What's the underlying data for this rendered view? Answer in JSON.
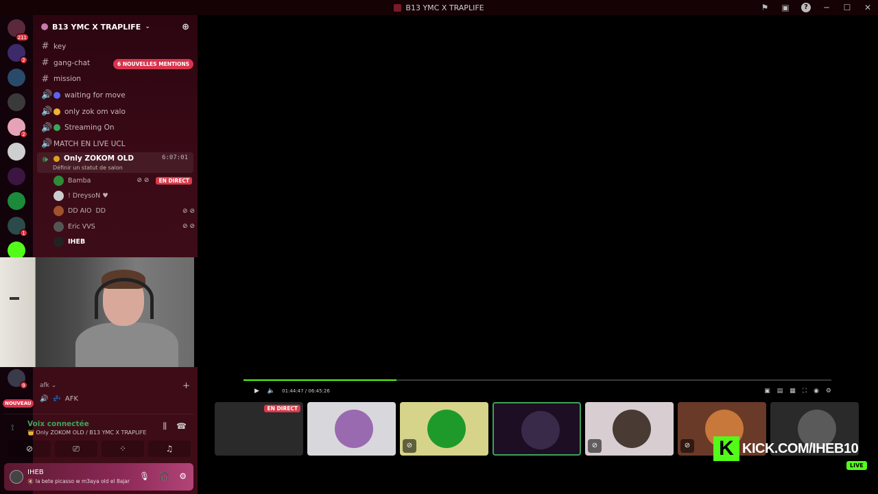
{
  "window": {
    "title": "B13 YMC X TRAPLIFE"
  },
  "rail": {
    "home_badge": "211",
    "servers": [
      {
        "color": "#3c2a6a",
        "badge": "2"
      },
      {
        "color": "#2a4a6a",
        "badge": ""
      },
      {
        "color": "#3a3a3a",
        "badge": ""
      },
      {
        "color": "#e6a3b8",
        "badge": "2"
      },
      {
        "color": "#cfcfcf",
        "badge": ""
      },
      {
        "color": "#3a1640",
        "badge": ""
      },
      {
        "color": "#1b8a3a",
        "badge": ""
      },
      {
        "color": "#2c4a4a",
        "badge": "1"
      },
      {
        "color": "#53fc18",
        "badge": ""
      }
    ]
  },
  "sidebar": {
    "server_name": "B13 YMC X TRAPLIFE",
    "mentions_badge": "6 NOUVELLES MENTIONS",
    "channels": [
      {
        "name": "key",
        "icon": "#"
      },
      {
        "name": "gang-chat",
        "icon": "#"
      },
      {
        "name": "mission",
        "icon": "#"
      },
      {
        "name": "waiting for move",
        "icon": "🔊",
        "dot": "#5865f2"
      },
      {
        "name": "only zok om valo",
        "icon": "🔊",
        "dot": "#f0b232"
      },
      {
        "name": "Streaming On",
        "icon": "🔊",
        "dot": "#3ba55c"
      },
      {
        "name": "MATCH EN LIVE UCL",
        "icon": "🔊"
      }
    ],
    "active_channel": {
      "name": "Only ZOKOM OLD",
      "time": "6:07:01",
      "subtitle": "Définir un statut de salon"
    },
    "voice_users": [
      {
        "name": "Bamba",
        "color": "#2e8b3a",
        "live": "EN DIRECT",
        "icons": "⊘ ⊘"
      },
      {
        "name": "! DreysoN ♥",
        "color": "#ccc",
        "live": "",
        "icons": ""
      },
      {
        "name": "DD AIO",
        "extra": "DD",
        "color": "#a0522d",
        "live": "",
        "icons": "⊘ ⊘"
      },
      {
        "name": "Eric VVS",
        "color": "#555",
        "live": "",
        "icons": "⊘ ⊘"
      },
      {
        "name": "IHEB",
        "color": "#222",
        "live": "",
        "icons": ""
      }
    ],
    "afk_category": "afk",
    "afk_channel": "AFK",
    "nouveau": "NOUVEAU",
    "bottom_badge": "9"
  },
  "voice": {
    "status": "Voix connectée",
    "location": "Only ZOKOM OLD / B13 YMC X TRAPLIFE"
  },
  "user": {
    "name": "IHEB",
    "status": "la bete picasso w m3aya old el 8ajar"
  },
  "player": {
    "time": "01:44:47 / 06:45:26",
    "progress": 0.26
  },
  "thumbnails": [
    {
      "bg": "#2a2a2a",
      "circle": "",
      "live": "EN DIRECT",
      "muted": false
    },
    {
      "bg": "#d8d8dc",
      "circle": "#9a6ab0",
      "live": "",
      "muted": false
    },
    {
      "bg": "#d6d48a",
      "circle": "#1e9a2a",
      "live": "",
      "muted": true
    },
    {
      "bg": "#1e0e24",
      "circle": "#3a2a4a",
      "live": "",
      "muted": false,
      "selected": true
    },
    {
      "bg": "#d8cdd0",
      "circle": "#4a3a34",
      "live": "",
      "muted": true
    },
    {
      "bg": "#6a3a28",
      "circle": "#c8783a",
      "live": "",
      "muted": true
    },
    {
      "bg": "#2a2a2a",
      "circle": "#5a5a5a",
      "live": "",
      "muted": false
    }
  ],
  "overlay": {
    "kick_logo": "K",
    "kick_url": "KICK.COM/IHEB10",
    "live": "LIVE"
  },
  "colors": {
    "accent_live": "#da3a4b",
    "kick_green": "#53fc18",
    "voice_green": "#3ba55c"
  }
}
